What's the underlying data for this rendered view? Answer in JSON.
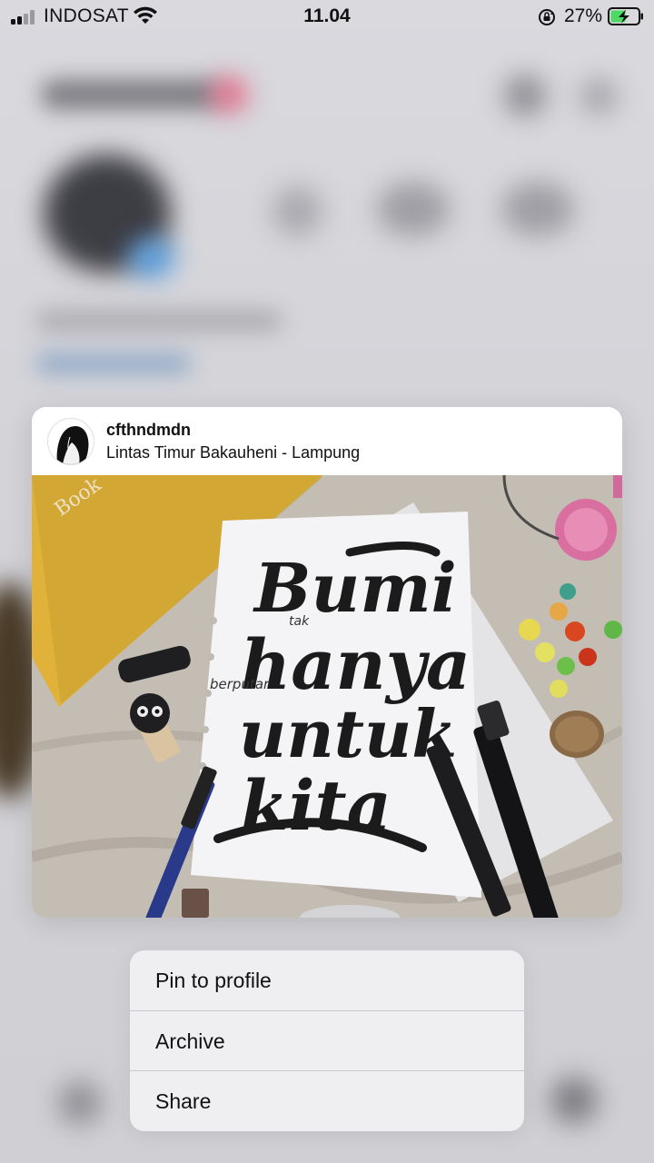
{
  "status_bar": {
    "carrier": "INDOSAT",
    "time": "11.04",
    "battery_percent": "27%",
    "icons": [
      "signal-icon",
      "wifi-icon",
      "rotation-lock-icon",
      "battery-charging-icon"
    ]
  },
  "preview": {
    "username": "cfthndmdn",
    "location": "Lintas Timur Bakauheni - Lampung",
    "image": {
      "lettering_lines": [
        "Bumi",
        "hanya",
        "untuk",
        "kita"
      ],
      "small_words": [
        "tak",
        "berputar"
      ],
      "book_text": "Book"
    }
  },
  "context_menu": {
    "items": [
      {
        "label": "Pin to profile"
      },
      {
        "label": "Archive"
      },
      {
        "label": "Share"
      }
    ]
  },
  "colors": {
    "menu_bg": "#f0f0f3",
    "text": "#111111",
    "battery_green": "#4cd964"
  }
}
